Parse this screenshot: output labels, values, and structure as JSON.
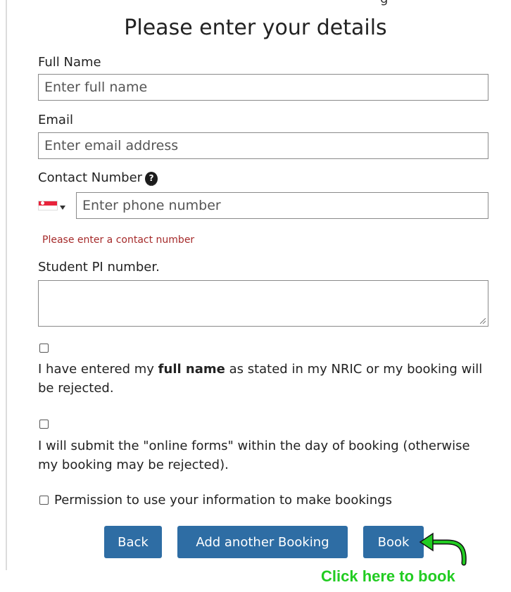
{
  "header": {
    "fragment": "g",
    "title": "Please enter your details"
  },
  "form": {
    "full_name": {
      "label": "Full Name",
      "placeholder": "Enter full name"
    },
    "email": {
      "label": "Email",
      "placeholder": "Enter email address"
    },
    "contact": {
      "label": "Contact Number",
      "help_icon": "question-circle-icon",
      "placeholder": "Enter phone number",
      "error": "Please enter a contact number"
    },
    "student_pi": {
      "label": "Student PI number."
    },
    "check_full_name": {
      "before": "I have entered my ",
      "bold": "full name",
      "after": " as stated in my NRIC or my booking will be rejected."
    },
    "check_online_forms": {
      "text": "I will submit the \"online forms\" within the day of booking (otherwise my booking may be rejected)."
    },
    "check_permission": {
      "text": "Permission to use your information to make bookings"
    }
  },
  "buttons": {
    "back": "Back",
    "add_another": "Add another Booking",
    "book": "Book"
  },
  "annotation": {
    "text": "Click here to book",
    "color": "#22cc22"
  },
  "colors": {
    "button_bg": "#2e6da4",
    "error": "#a52a2a"
  }
}
